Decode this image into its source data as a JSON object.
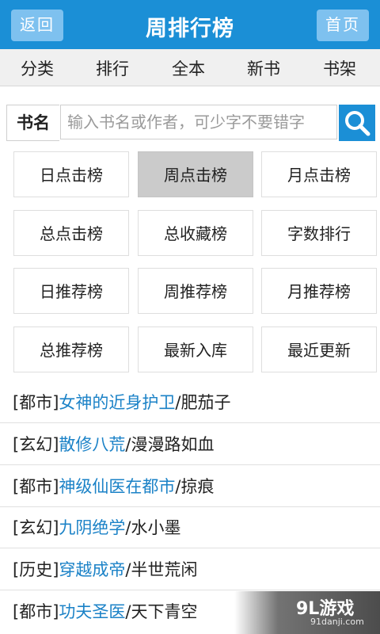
{
  "header": {
    "title": "周排行榜",
    "back_label": "返回",
    "home_label": "首页"
  },
  "nav": {
    "items": [
      "分类",
      "排行",
      "全本",
      "新书",
      "书架"
    ]
  },
  "search": {
    "label": "书名",
    "placeholder": "输入书名或作者，可少字不要错字",
    "button_icon": "search-icon"
  },
  "ranks": {
    "items": [
      {
        "label": "日点击榜",
        "active": false
      },
      {
        "label": "周点击榜",
        "active": true
      },
      {
        "label": "月点击榜",
        "active": false
      },
      {
        "label": "总点击榜",
        "active": false
      },
      {
        "label": "总收藏榜",
        "active": false
      },
      {
        "label": "字数排行",
        "active": false
      },
      {
        "label": "日推荐榜",
        "active": false
      },
      {
        "label": "周推荐榜",
        "active": false
      },
      {
        "label": "月推荐榜",
        "active": false
      },
      {
        "label": "总推荐榜",
        "active": false
      },
      {
        "label": "最新入库",
        "active": false
      },
      {
        "label": "最近更新",
        "active": false
      }
    ]
  },
  "books": [
    {
      "genre": "[都市]",
      "title": "女神的近身护卫",
      "sep": "/",
      "author": "肥茄子"
    },
    {
      "genre": "[玄幻]",
      "title": "散修八荒",
      "sep": "/",
      "author": "漫漫路如血"
    },
    {
      "genre": "[都市]",
      "title": "神级仙医在都市",
      "sep": "/",
      "author": "掠痕"
    },
    {
      "genre": "[玄幻]",
      "title": "九阴绝学",
      "sep": "/",
      "author": "水小墨"
    },
    {
      "genre": "[历史]",
      "title": "穿越成帝",
      "sep": "/",
      "author": "半世荒闲"
    },
    {
      "genre": "[都市]",
      "title": "功夫圣医",
      "sep": "/",
      "author": "天下青空"
    }
  ],
  "watermark": {
    "brand": "9L游戏",
    "site": "91danji.com"
  },
  "colors": {
    "header_bg": "#1b8fd6",
    "link": "#1b82c7",
    "active_tab": "#cbcbcb"
  }
}
